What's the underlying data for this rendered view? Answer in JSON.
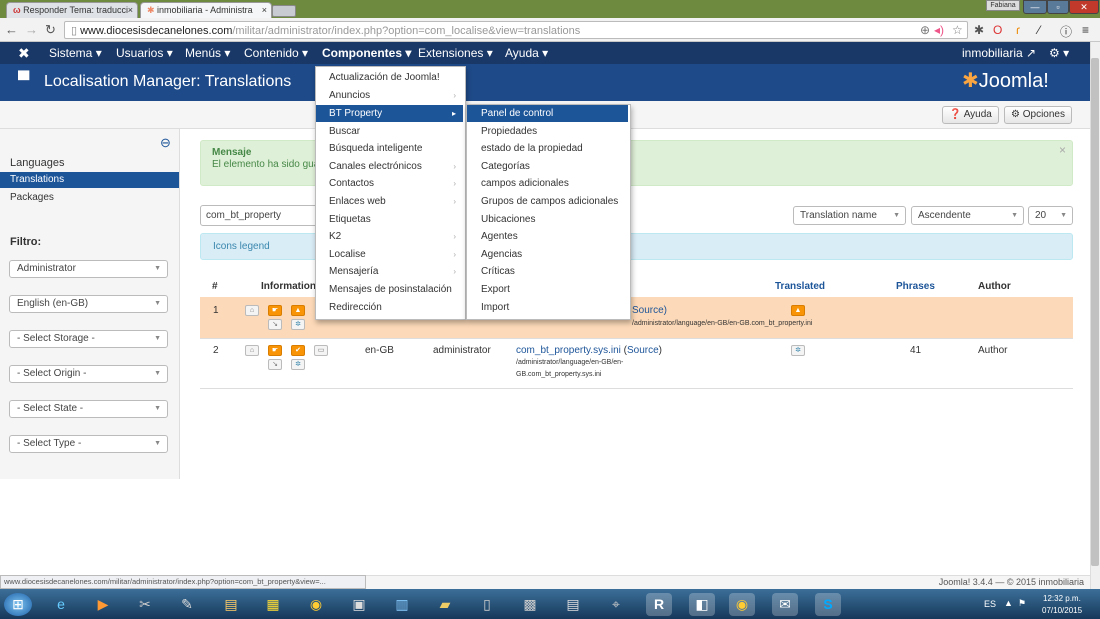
{
  "browser": {
    "tabs": [
      {
        "title": "Responder Tema: traducci",
        "icon": "forum-tab-icon"
      },
      {
        "title": "inmobiliaria - Administra",
        "icon": "joomla-tab-icon"
      }
    ],
    "window_user": "Fabiana",
    "url_host": "www.diocesisdecanelones.com",
    "url_path": "/militar/administrator/index.php?option=com_localise&view=translations"
  },
  "navbar": {
    "logo_icon": "joomla-icon",
    "menus": [
      "Sistema",
      "Usuarios",
      "Menús",
      "Contenido",
      "Componentes",
      "Extensiones",
      "Ayuda"
    ],
    "site_name": "inmobiliaria",
    "settings_icon": "gear-icon"
  },
  "header": {
    "title": "Localisation Manager: Translations",
    "brand": "Joomla!"
  },
  "toolbar": {
    "help_label": "Ayuda",
    "options_label": "Opciones"
  },
  "sidebar": {
    "items": [
      "Languages",
      "Translations",
      "Packages"
    ],
    "active": "Translations",
    "filter_title": "Filtro:",
    "filters": [
      "Administrator",
      "English (en-GB)",
      "- Select Storage -",
      "- Select Origin -",
      "- Select State -",
      "- Select Type -"
    ]
  },
  "message": {
    "title": "Mensaje",
    "text": "El elemento ha sido gua"
  },
  "search": {
    "value": "com_bt_property"
  },
  "list_controls": {
    "sort_field": "Translation name",
    "sort_dir": "Ascendente",
    "limit": "20"
  },
  "legend_label": "Icons legend",
  "table": {
    "headers": [
      "#",
      "Information",
      "Translated",
      "Phrases",
      "Author"
    ],
    "rows": [
      {
        "num": "1",
        "lang": "",
        "client": "",
        "file_tail": "Source)",
        "path": "/administrator/language/en-GB/en-GB.com_bt_property.ini",
        "phrases": "",
        "author": ""
      },
      {
        "num": "2",
        "lang": "en-GB",
        "client": "administrator",
        "file": "com_bt_property.sys.ini",
        "source": "Source",
        "path1": "/administrator/language/en-GB/en-",
        "path2": "GB.com_bt_property.sys.ini",
        "phrases": "41",
        "author": "Author"
      }
    ]
  },
  "components_menu": [
    {
      "label": "Actualización de Joomla!",
      "submenu": false
    },
    {
      "label": "Anuncios",
      "submenu": true
    },
    {
      "label": "BT Property",
      "submenu": true,
      "highlighted": true
    },
    {
      "label": "Buscar",
      "submenu": false
    },
    {
      "label": "Búsqueda inteligente",
      "submenu": false
    },
    {
      "label": "Canales electrónicos",
      "submenu": true
    },
    {
      "label": "Contactos",
      "submenu": true
    },
    {
      "label": "Enlaces web",
      "submenu": true
    },
    {
      "label": "Etiquetas",
      "submenu": false
    },
    {
      "label": "K2",
      "submenu": true
    },
    {
      "label": "Localise",
      "submenu": true
    },
    {
      "label": "Mensajería",
      "submenu": true
    },
    {
      "label": "Mensajes de posinstalación",
      "submenu": false
    },
    {
      "label": "Redirección",
      "submenu": false
    }
  ],
  "bt_property_submenu": [
    "Panel de control",
    "Propiedades",
    "estado de la propiedad",
    "Categorías",
    "campos adicionales",
    "Grupos de campos adicionales",
    "Ubicaciones",
    "Agentes",
    "Agencias",
    "Críticas",
    "Export",
    "Import"
  ],
  "status_url": "www.diocesisdecanelones.com/militar/administrator/index.php?option=com_bt_property&view=...",
  "footer": "Joomla! 3.4.4 — © 2015 inmobiliaria",
  "taskbar": {
    "lang": "ES",
    "time": "12:32 p.m.",
    "date": "07/10/2015",
    "apps": [
      "start-icon",
      "ie-icon",
      "media-player-icon",
      "paint-icon",
      "pen-tool-icon",
      "folder-icon",
      "apps-grid-icon",
      "chrome-icon",
      "calculator-icon",
      "document-icon",
      "ruler-icon",
      "phone-icon",
      "printer-icon",
      "notepad-icon",
      "network-icon",
      "r-app-icon",
      "vpn-icon",
      "chrome-icon",
      "mail-icon",
      "skype-icon"
    ]
  },
  "colors": {
    "navbar": "#1a3867",
    "header": "#1e4a89",
    "accent": "#1d5599",
    "row_warning": "#fcd9b8",
    "message_bg": "#dff0d8"
  }
}
